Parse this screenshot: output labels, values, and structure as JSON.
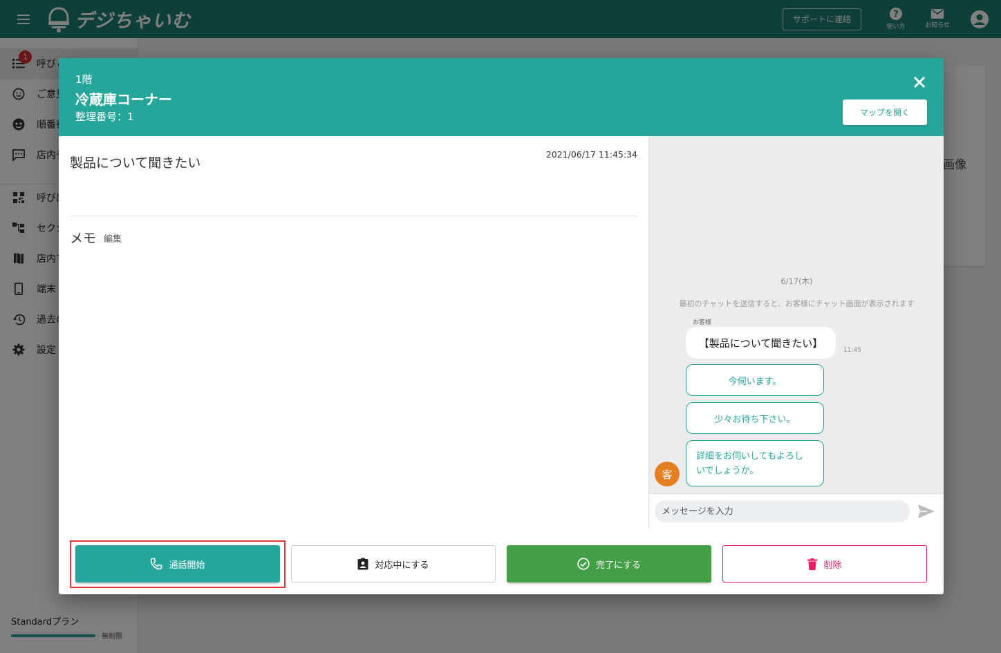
{
  "app": {
    "logo_text": "デジちゃいむ",
    "support_label": "サポートに連絡",
    "help_label": "使い方",
    "notice_label": "お知らせ"
  },
  "sidebar": {
    "badge_count": "1",
    "items": [
      {
        "label": "呼びｄ",
        "icon": "list-icon"
      },
      {
        "label": "ご意見",
        "icon": "feedback-icon"
      },
      {
        "label": "順番待",
        "icon": "queue-icon"
      },
      {
        "label": "店内チ",
        "icon": "chat-icon"
      },
      {
        "label": "呼び出",
        "icon": "qr-icon"
      },
      {
        "label": "セクシ",
        "icon": "section-icon"
      },
      {
        "label": "店内マ",
        "icon": "map-icon"
      },
      {
        "label": "端末",
        "icon": "device-icon"
      },
      {
        "label": "過去の",
        "icon": "history-icon"
      },
      {
        "label": "設定",
        "icon": "settings-icon"
      }
    ],
    "plan_label": "Standardプラン",
    "plan_limit": "無制限"
  },
  "background": {
    "image_label": "画像"
  },
  "dialog": {
    "floor": "1階",
    "place": "冷蔵庫コーナー",
    "serial": "整理番号：1",
    "map_button": "マップを開く",
    "subject": "製品について聞きたい",
    "timestamp": "2021/06/17 11:45:34",
    "memo_label": "メモ",
    "memo_edit": "編集"
  },
  "chat": {
    "date": "6/17(木)",
    "hint": "最初のチャットを送信すると、お客様にチャット画面が表示されます",
    "sender": "お客様",
    "message": "【製品について聞きたい】",
    "message_time": "11:45",
    "quick_replies": [
      "今伺います。",
      "少々お待ち下さい。",
      "詳細をお伺いしてもよろしいでしょうか。"
    ],
    "quick_line1": "詳細をお伺いしてもよろし",
    "quick_line2": "いでしょうか。",
    "avatar_label": "客",
    "input_placeholder": "メッセージを入力"
  },
  "actions": {
    "call": "通話開始",
    "handling": "対応中にする",
    "done": "完了にする",
    "delete": "削除"
  },
  "colors": {
    "header": "#1e7f73",
    "accent": "#26a69a",
    "done": "#43a047",
    "delete": "#e91e63",
    "highlight": "#e53935",
    "customer_avatar": "#e67e22"
  }
}
